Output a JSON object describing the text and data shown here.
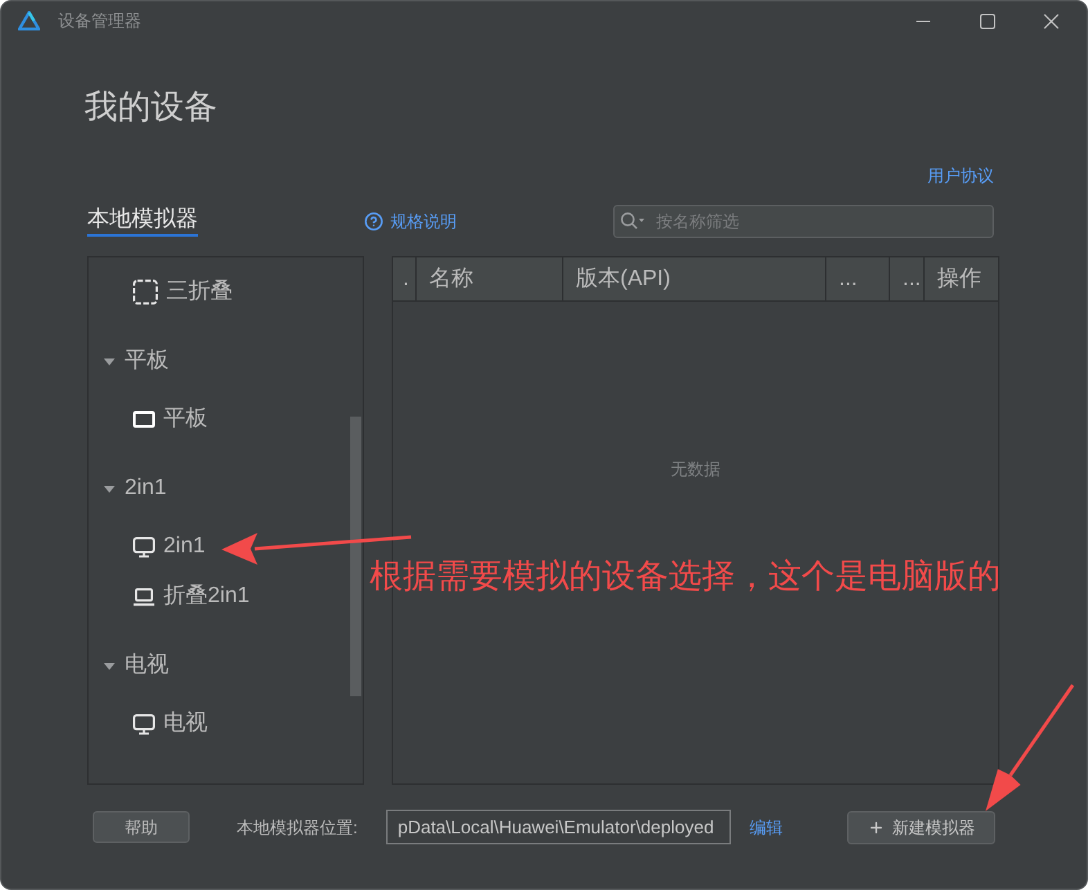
{
  "window": {
    "title": "设备管理器"
  },
  "page": {
    "heading": "我的设备",
    "user_agreement_link": "用户协议"
  },
  "tabs": [
    {
      "label": "本地模拟器",
      "selected": true
    }
  ],
  "spec_link": "规格说明",
  "search": {
    "placeholder": "按名称筛选"
  },
  "device_tree": {
    "items": [
      {
        "kind": "trifold",
        "label": "三折叠"
      },
      {
        "kind": "category",
        "label": "平板",
        "expanded": true,
        "children": [
          {
            "kind": "tablet",
            "label": "平板"
          }
        ]
      },
      {
        "kind": "category",
        "label": "2in1",
        "expanded": true,
        "children": [
          {
            "kind": "desktop",
            "label": "2in1"
          },
          {
            "kind": "laptop",
            "label": "折叠2in1"
          }
        ]
      },
      {
        "kind": "category",
        "label": "电视",
        "expanded": true,
        "children": [
          {
            "kind": "tv",
            "label": "电视"
          }
        ]
      }
    ]
  },
  "table": {
    "columns": [
      ".",
      "名称",
      "版本(API)",
      "...",
      "...",
      "操作"
    ],
    "empty_text": "无数据"
  },
  "footer": {
    "help_button": "帮助",
    "location_label": "本地模拟器位置:",
    "location_value": "pData\\Local\\Huawei\\Emulator\\deployed",
    "edit_link": "编辑",
    "new_button": "新建模拟器"
  },
  "annotation": {
    "text": "根据需要模拟的设备选择，这个是电脑版的"
  }
}
